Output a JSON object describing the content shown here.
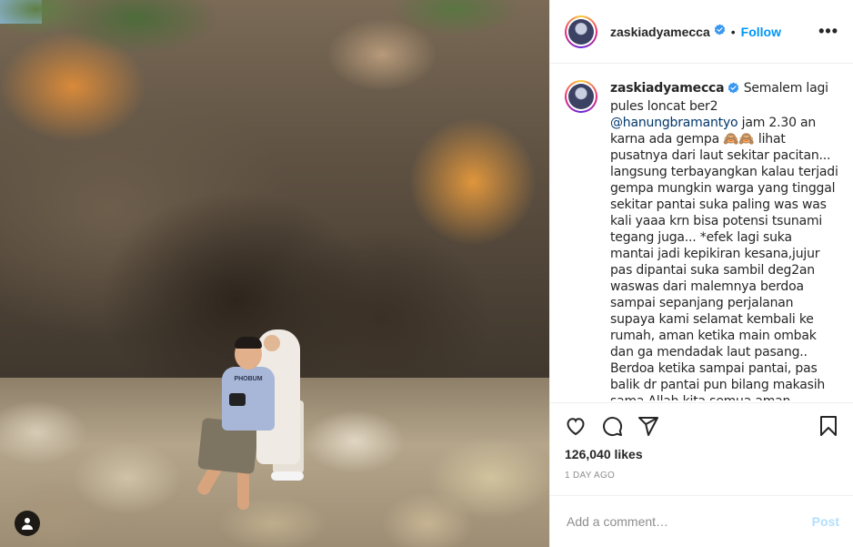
{
  "post": {
    "username": "zaskiadyamecca",
    "follow_label": "Follow",
    "separator": "•",
    "more_label": "•••",
    "caption_user": "zaskiadyamecca",
    "caption_part1": "Semalem lagi pules loncat ber2",
    "mention": "@hanungbramantyo",
    "caption_part2": " jam 2.30 an karna ada gempa 🙈🙈 lihat pusatnya dari laut sekitar pacitan... langsung terbayangkan kalau terjadi gempa mungkin warga yang tinggal sekitar pantai suka paling was was kali yaaa krn bisa potensi tsunami tegang juga... *efek lagi suka mantai jadi kepikiran kesana,jujur pas dipantai suka sambil deg2an waswas dari malemnya berdoa sampai sepanjang perjalanan supaya kami selamat kembali ke rumah, aman ketika main ombak dan ga mendadak laut pasang.. Berdoa ketika sampai pantai, pas balik dr pantai pun bilang makasih sama Allah kita semua aman",
    "likes": "126,040 likes",
    "time_ago": "1 DAY AGO",
    "comment_placeholder": "Add a comment…",
    "post_label": "Post"
  },
  "photo": {
    "shirt_text": "PHOBUM"
  },
  "icons": {
    "verified": "verified-badge-icon",
    "like": "heart-icon",
    "comment": "comment-bubble-icon",
    "share": "paper-plane-icon",
    "save": "bookmark-icon",
    "tag": "user-tag-icon"
  },
  "colors": {
    "link": "#0095f6",
    "mention": "#00376b",
    "post_disabled": "#b2dffc",
    "muted": "#8e8e8e"
  }
}
